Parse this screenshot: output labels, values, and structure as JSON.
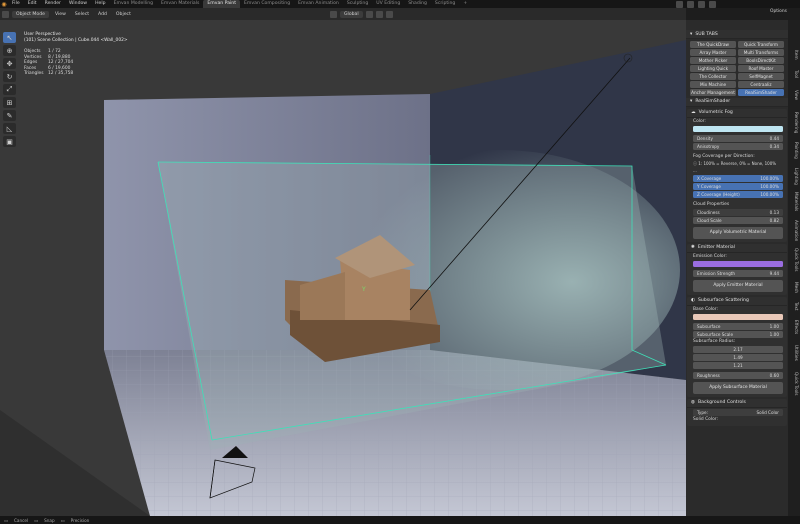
{
  "menu": {
    "items": [
      "File",
      "Edit",
      "Render",
      "Window",
      "Help"
    ],
    "workspaces": [
      "Emvan Modelling",
      "Emvan Materials",
      "Emvan Paint",
      "Emvan Compositing",
      "Emvan Animation",
      "Sculpting",
      "UV Editing",
      "Shading",
      "Scripting"
    ],
    "active_workspace": "Emvan Paint",
    "add_tab": "+",
    "options": "Options"
  },
  "header": {
    "mode": "Object Mode",
    "menus": [
      "View",
      "Select",
      "Add",
      "Object"
    ],
    "transform_orientation": "Global"
  },
  "viewport": {
    "view_name": "User Perspective",
    "collection_line": "(101) Scene Collection | Cube.044 <Wall_002>",
    "stats": [
      {
        "key": "Objects",
        "value": "1 / 72"
      },
      {
        "key": "Vertices",
        "value": "8 / 19,880"
      },
      {
        "key": "Edges",
        "value": "12 / 27,704"
      },
      {
        "key": "Faces",
        "value": "6 / 19,600"
      },
      {
        "key": "Triangles",
        "value": "12 / 35,758"
      }
    ],
    "axis_label": "Y",
    "colors": {
      "volume_outline": "#3fe0b8",
      "bg": "#393939",
      "backdrop": "#8d91a8"
    }
  },
  "sidebar": {
    "subtabs_title": "SUB TABS",
    "subtabs": [
      "The QuickDraw",
      "Quick Transform",
      "Array Master",
      "Multi Transforms",
      "Mother Picker",
      "BoolsDirectKit",
      "Lighting Quick",
      "Roof Master",
      "The Collector",
      "SelfMagnet",
      "Mix Machine",
      "Centraaliz",
      "Anchor Management",
      "RealSimShader"
    ],
    "active_subtab": "RealSimShader",
    "shader_title": "RealSimShader",
    "volumetric": {
      "title": "Volumetric Fog",
      "color_label": "Color:",
      "color": "#bfe6f2",
      "density_label": "Density",
      "density": "0.44",
      "anisotropy_label": "Anisotropy",
      "anisotropy": "0.34",
      "coverage_title": "Fog Coverage per Direction:",
      "coverage_note": "1: 100% = Reverse, 0% = None, 100% ...",
      "x_label": "X Coverage",
      "x_value": "100.00%",
      "y_label": "Y Coverage",
      "y_value": "100.00%",
      "z_label": "Z Coverage (Height)",
      "z_value": "100.00%",
      "cloud_title": "Cloud Properties",
      "cloudiness_label": "Cloudiness",
      "cloudiness": "0.13",
      "cloud_scale_label": "Cloud Scale",
      "cloud_scale": "0.82",
      "apply": "Apply Volumetric Material"
    },
    "emitter": {
      "title": "Emitter Material",
      "color_label": "Emission Color:",
      "color": "#9a6de0",
      "strength_label": "Emission Strength",
      "strength": "9.44",
      "apply": "Apply Emitter Material"
    },
    "subsurface": {
      "title": "Subsurface Scattering",
      "base_label": "Base Color:",
      "base_color": "#e9c8b8",
      "subsurface_label": "Subsurface",
      "subsurface": "1.00",
      "scale_label": "Subsurface Scale",
      "scale": "1.00",
      "radius_label": "Subsurface Radius:",
      "radius": [
        "2.17",
        "1.49",
        "1.21"
      ],
      "roughness_label": "Roughness",
      "roughness": "0.60",
      "apply": "Apply Subsurface Material"
    },
    "background": {
      "title": "Background Controls",
      "type_label": "Type:",
      "type_value": "Solid Color",
      "solid_label": "Solid Color:"
    },
    "vertical_tabs": [
      "Item",
      "Tool",
      "View",
      "Rendering",
      "Painting",
      "Lighting",
      "Materials",
      "Animation",
      "Quick Tools",
      "Mesh",
      "Text",
      "Effects",
      "Utilities",
      "Quick Tools"
    ]
  },
  "status": {
    "items": [
      "Cancel",
      "Snap",
      "Precision"
    ]
  }
}
